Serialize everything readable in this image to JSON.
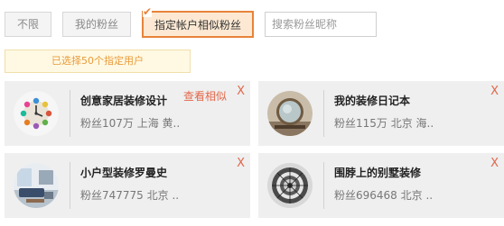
{
  "filters": {
    "all_label": "不限",
    "my_fans_label": "我的粉丝",
    "similar_fans_label": "指定帐户相似粉丝",
    "check_icon": "check-icon"
  },
  "search": {
    "placeholder": "搜索粉丝昵称",
    "value": ""
  },
  "selected_tip": "已选择50个指定用户",
  "cards": [
    {
      "name": "创意家居装修设计",
      "meta": "粉丝107万  上海 黄..",
      "action": "查看相似",
      "close": "X",
      "avatar": "clock-decor-avatar"
    },
    {
      "name": "我的装修日记本",
      "meta": "粉丝115万  北京 海..",
      "close": "X",
      "avatar": "round-mirror-avatar"
    },
    {
      "name": "小户型装修罗曼史",
      "meta": "粉丝747775  北京 ..",
      "close": "X",
      "avatar": "living-room-avatar"
    },
    {
      "name": "围脖上的别墅装修",
      "meta": "粉丝696468  北京 ..",
      "close": "X",
      "avatar": "bw-staircase-avatar"
    }
  ],
  "colors": {
    "accent_orange": "#e8833a",
    "close_red": "#e2674a",
    "tip_text": "#e89b3a"
  }
}
